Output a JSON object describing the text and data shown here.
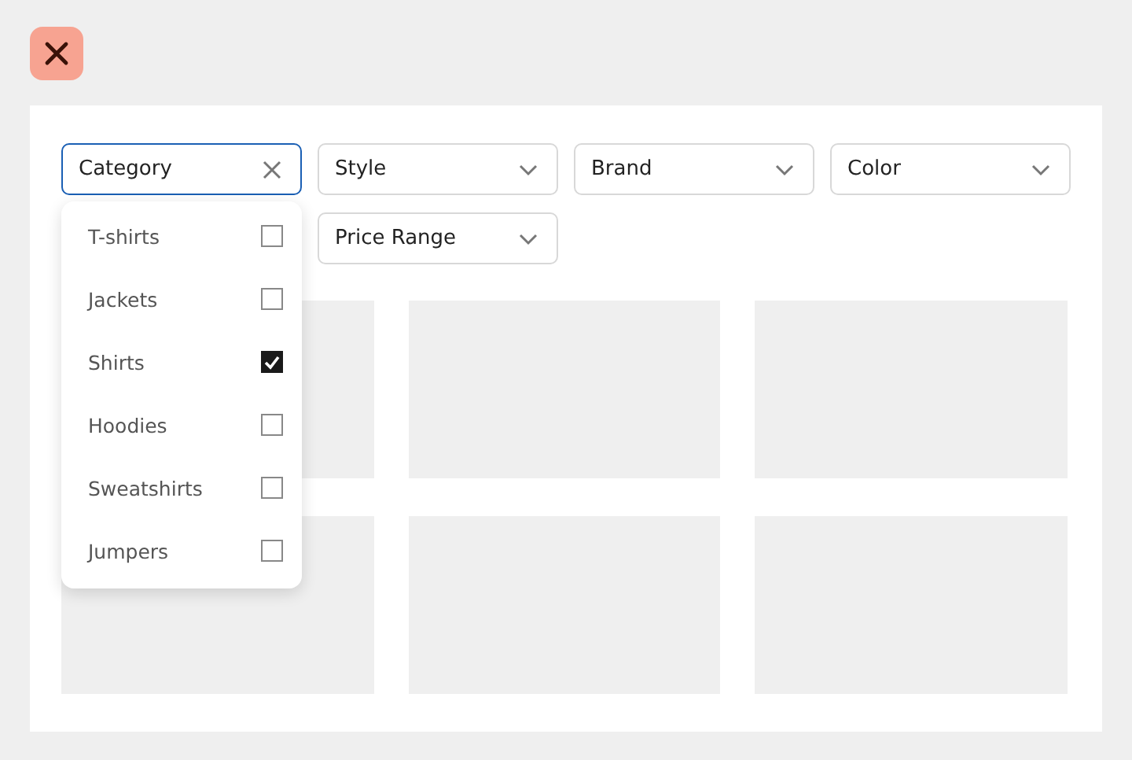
{
  "filters": [
    {
      "label": "Category",
      "expanded": true,
      "options": [
        {
          "label": "T-shirts",
          "checked": false
        },
        {
          "label": "Jackets",
          "checked": false
        },
        {
          "label": "Shirts",
          "checked": true
        },
        {
          "label": "Hoodies",
          "checked": false
        },
        {
          "label": "Sweatshirts",
          "checked": false
        },
        {
          "label": "Jumpers",
          "checked": false
        }
      ]
    },
    {
      "label": "Style",
      "expanded": false
    },
    {
      "label": "Brand",
      "expanded": false
    },
    {
      "label": "Color",
      "expanded": false
    },
    {
      "label": "Price Range",
      "expanded": false
    }
  ],
  "tiles": [
    {
      "kind": "placeholder"
    },
    {
      "kind": "placeholder"
    },
    {
      "kind": "placeholder"
    },
    {
      "kind": "placeholder"
    },
    {
      "kind": "placeholder"
    },
    {
      "kind": "placeholder"
    }
  ]
}
